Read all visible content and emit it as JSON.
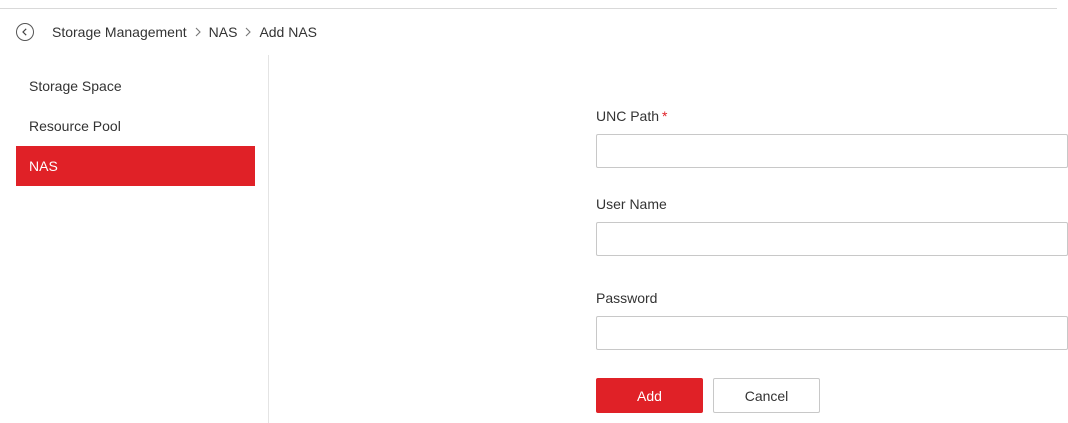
{
  "header": {
    "back_icon": "chevron-left-circle-icon",
    "breadcrumb": [
      "Storage Management",
      "NAS",
      "Add NAS"
    ],
    "separator_icon": "chevron-right-icon"
  },
  "sidebar": {
    "items": [
      {
        "label": "Storage Space",
        "active": false
      },
      {
        "label": "Resource Pool",
        "active": false
      },
      {
        "label": "NAS",
        "active": true
      }
    ]
  },
  "form": {
    "unc_path": {
      "label": "UNC Path",
      "required_mark": "*",
      "value": ""
    },
    "user_name": {
      "label": "User Name",
      "value": ""
    },
    "password": {
      "label": "Password",
      "value": ""
    }
  },
  "buttons": {
    "add_label": "Add",
    "cancel_label": "Cancel"
  },
  "colors": {
    "accent": "#e02127",
    "text": "#333333",
    "border": "#c8c8c8"
  }
}
